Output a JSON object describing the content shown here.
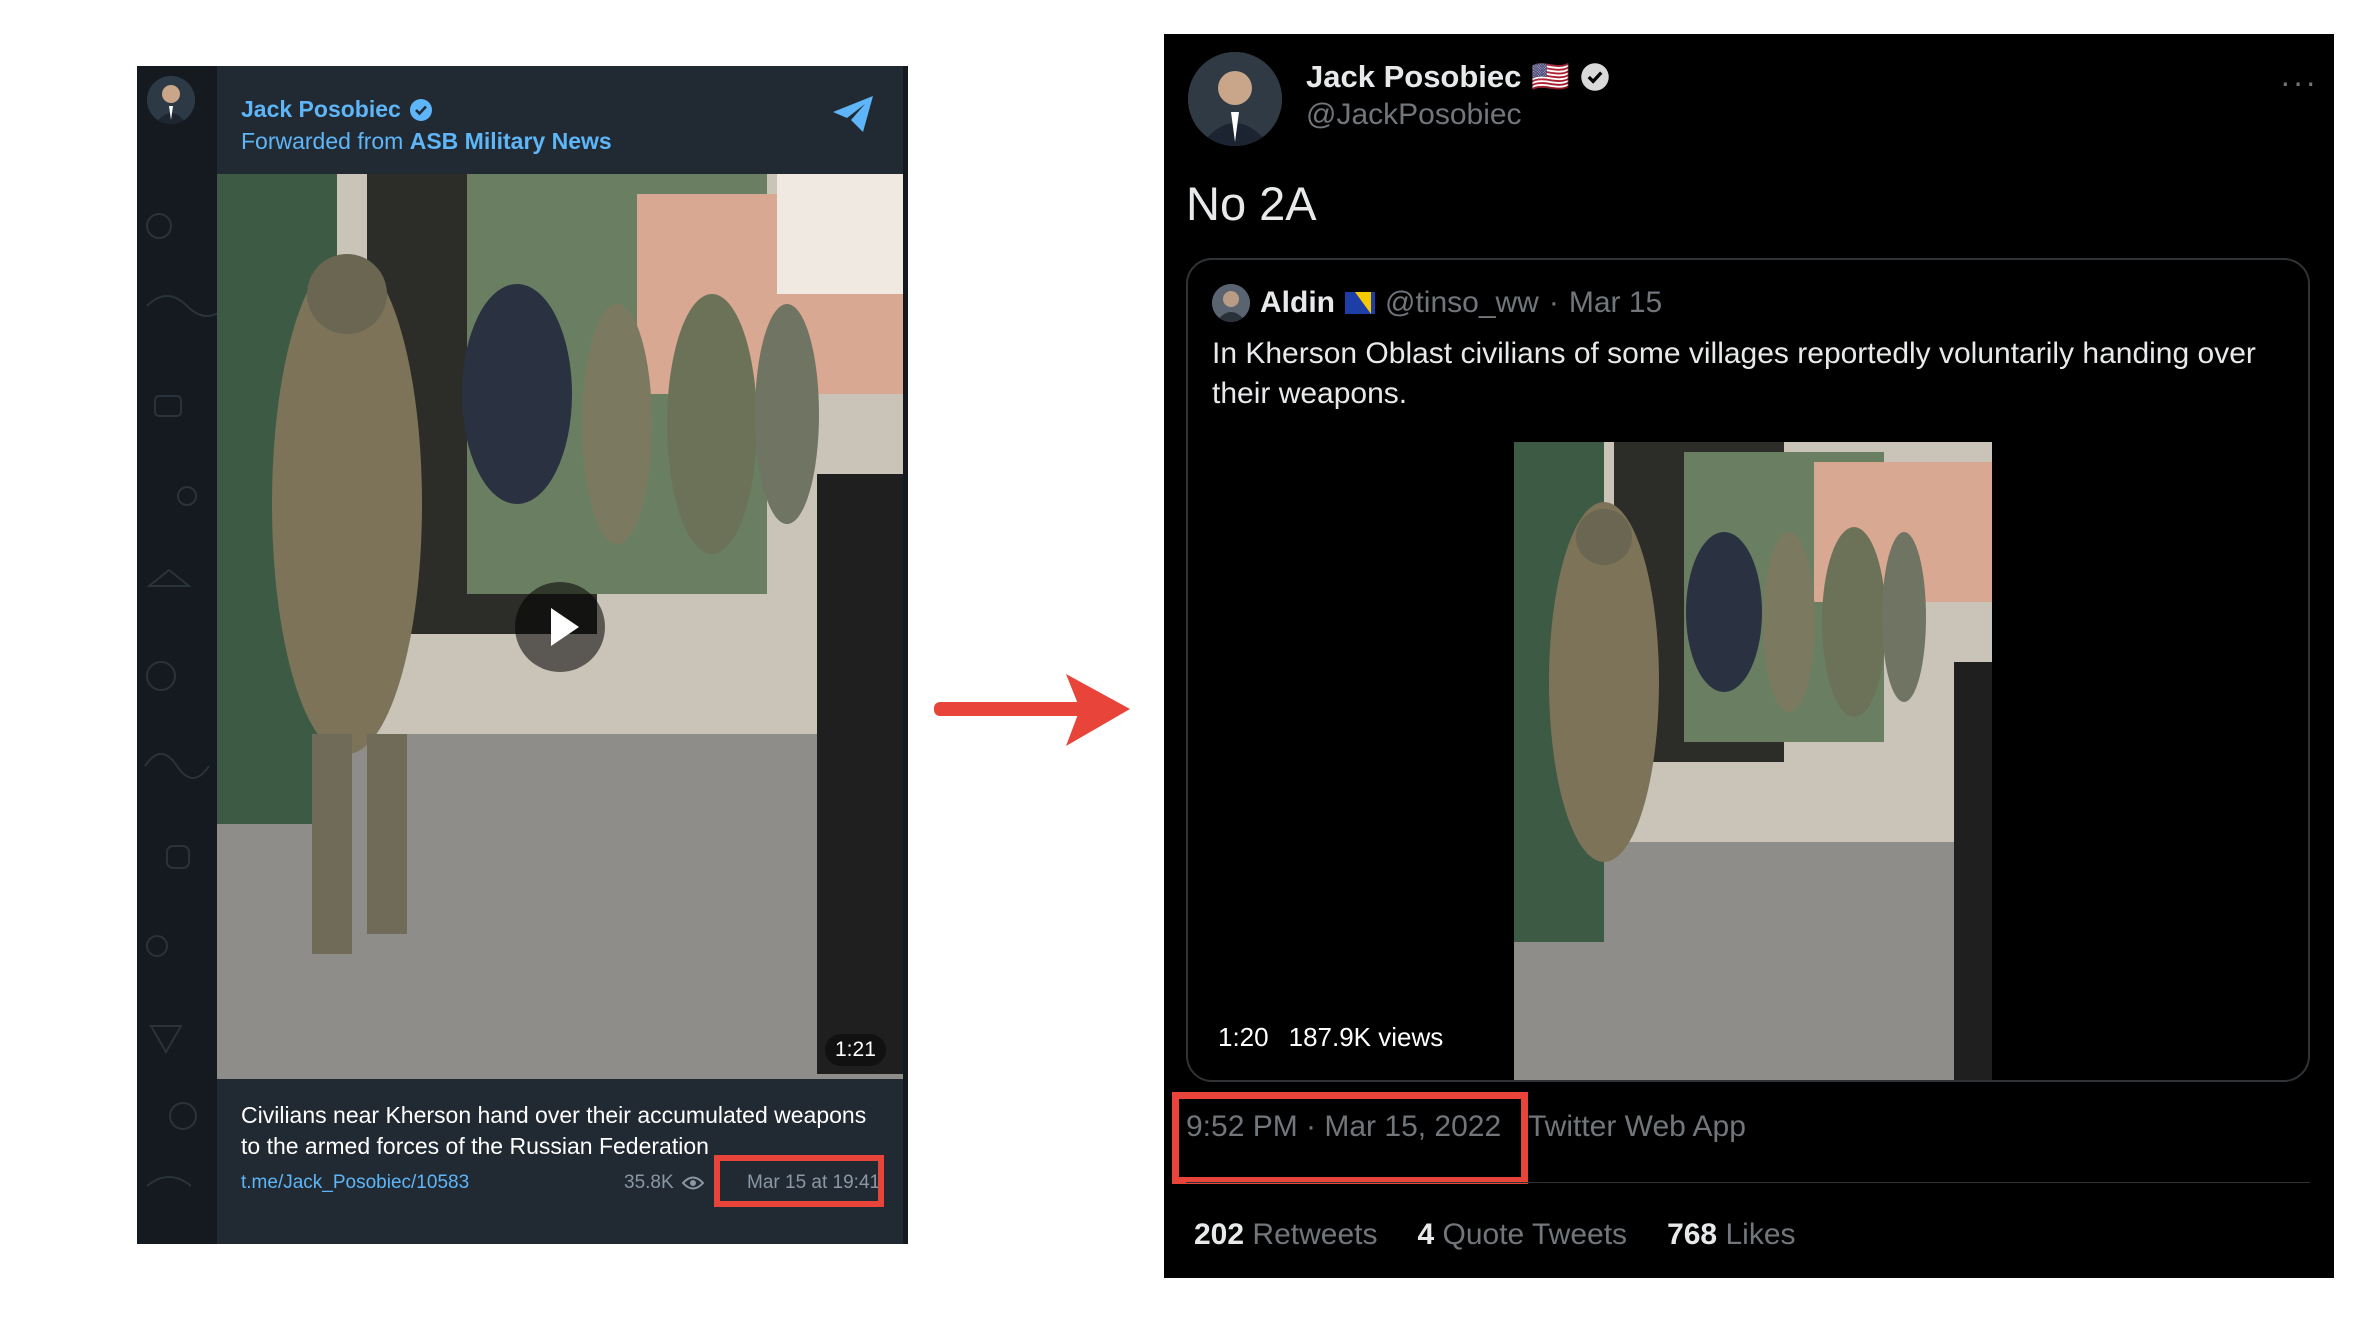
{
  "telegram": {
    "sender_name": "Jack Posobiec",
    "forward_prefix": "Forwarded from",
    "forward_source": "ASB Military News",
    "video_duration": "1:21",
    "caption": "Civilians near Kherson hand over their accumulated weapons to the armed forces of the Russian Federation",
    "link": "t.me/Jack_Posobiec/10583",
    "views": "35.8K",
    "timestamp": "Mar 15 at 19:41",
    "colors": {
      "panel_bg": "#212a33",
      "link": "#5eb5f7",
      "highlight": "#e8443a"
    },
    "icons": [
      "verified-badge-icon",
      "telegram-share-icon",
      "eye-icon",
      "play-icon"
    ]
  },
  "twitter": {
    "author_name": "Jack Posobiec",
    "author_flag": "🇺🇸",
    "author_handle": "@JackPosobiec",
    "more_label": "···",
    "tweet_text": "No 2A",
    "quote": {
      "name": "Aldin",
      "handle": "@tinso_ww",
      "separator": "·",
      "date": "Mar 15",
      "text": "In Kherson Oblast civilians of some villages reportedly voluntarily handing over their weapons.",
      "duration": "1:20",
      "views": "187.9K views"
    },
    "timestamp": "9:52 PM · Mar 15, 2022",
    "source_app": "Twitter Web App",
    "metrics": [
      {
        "value": "202",
        "label": "Retweets"
      },
      {
        "value": "4",
        "label": "Quote Tweets"
      },
      {
        "value": "768",
        "label": "Likes"
      }
    ],
    "colors": {
      "bg": "#000000",
      "text": "#e7e9ea",
      "muted": "#71767b",
      "highlight": "#e8443a"
    }
  },
  "arrow_color": "#e8443a"
}
